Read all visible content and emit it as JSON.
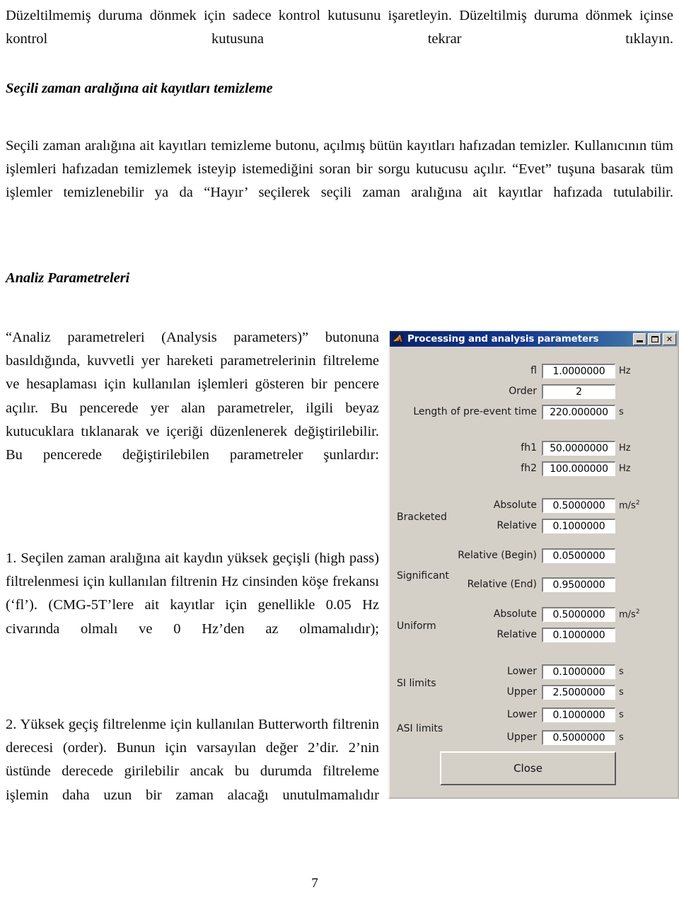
{
  "document": {
    "paragraphs": [
      {
        "id": "p1",
        "text": "Düzeltilmemiş duruma dönmek için sadece kontrol kutusunu işaretleyin. Düzeltilmiş duruma dönmek içinse kontrol kutusuna tekrar tıklayın."
      },
      {
        "id": "p2",
        "text": "Seçili zaman aralığına ait kayıtları temizleme butonu, açılmış bütün kayıtları hafızadan temizler. Kullanıcının tüm işlemleri hafızadan temizlemek isteyip istemediğini soran bir sorgu kutucusu açılır. “Evet” tuşuna basarak tüm işlemler temizlenebilir ya da “Hayır’ seçilerek seçili zaman aralığına ait kayıtlar hafızada tutulabilir."
      },
      {
        "id": "p3",
        "text": "“Analiz parametreleri (Analysis parameters)” butonuna basıldığında, kuvvetli yer hareketi parametrelerinin filtreleme ve hesaplaması için kullanılan işlemleri gösteren bir pencere açılır. Bu pencerede yer alan parametreler, ilgili beyaz kutucuklara tıklanarak ve içeriği düzenlenerek değiştirilebilir. Bu pencerede değiştirilebilen parametreler şunlardır:"
      },
      {
        "id": "p4",
        "text": "1. Seçilen zaman aralığına ait kaydın yüksek geçişli (high pass) filtrelenmesi için kullanılan filtrenin Hz cinsinden köşe frekansı (‘fl’). (CMG-5T’lere ait kayıtlar için genellikle 0.05 Hz civarında olmalı ve 0 Hz’den az olmamalıdır);"
      },
      {
        "id": "p5",
        "text": "2. Yüksek geçiş filtrelenme için kullanılan Butterworth filtrenin derecesi (order). Bunun için varsayılan değer 2’dir. 2’nin üstünde derecede girilebilir ancak bu durumda filtreleme işlemin daha uzun bir zaman alacağı unutulmamalıdır"
      }
    ],
    "headings": [
      {
        "id": "h1",
        "text": "Seçili zaman aralığına ait kayıtları temizleme"
      },
      {
        "id": "h2",
        "text": "Analiz Parametreleri"
      }
    ],
    "page_number": "7"
  },
  "dialog": {
    "title": "Processing and analysis parameters",
    "icon": "matlab-logo-icon",
    "window_controls": {
      "minimize": "minimize-icon",
      "maximize": "maximize-icon",
      "close": "close-icon"
    },
    "close_button_label": "Close",
    "rows": [
      {
        "group": "",
        "label": "fl",
        "value": "1.0000000",
        "unit": "Hz",
        "unit_sup": "",
        "label_wide": false
      },
      {
        "group": "",
        "label": "Order",
        "value": "2",
        "unit": "",
        "unit_sup": "",
        "label_wide": false
      },
      {
        "group": "",
        "label": "Length of pre-event time",
        "value": "220.000000",
        "unit": "s",
        "unit_sup": "",
        "label_wide": true
      },
      {
        "group": "",
        "label": "fh1",
        "value": "50.0000000",
        "unit": "Hz",
        "unit_sup": "",
        "label_wide": false
      },
      {
        "group": "",
        "label": "fh2",
        "value": "100.000000",
        "unit": "Hz",
        "unit_sup": "",
        "label_wide": false
      },
      {
        "group": "",
        "label": "Absolute",
        "value": "0.5000000",
        "unit": "m/s",
        "unit_sup": "2",
        "label_wide": false
      },
      {
        "group": "Bracketed",
        "label": "Relative",
        "value": "0.1000000",
        "unit": "",
        "unit_sup": "",
        "label_wide": false
      },
      {
        "group": "",
        "label": "Relative (Begin)",
        "value": "0.0500000",
        "unit": "",
        "unit_sup": "",
        "label_wide": false
      },
      {
        "group": "Significant",
        "label": "Relative (End)",
        "value": "0.9500000",
        "unit": "",
        "unit_sup": "",
        "label_wide": false
      },
      {
        "group": "",
        "label": "Absolute",
        "value": "0.5000000",
        "unit": "m/s",
        "unit_sup": "2",
        "label_wide": false
      },
      {
        "group": "Uniform",
        "label": "Relative",
        "value": "0.1000000",
        "unit": "",
        "unit_sup": "",
        "label_wide": false
      },
      {
        "group": "",
        "label": "Lower",
        "value": "0.1000000",
        "unit": "s",
        "unit_sup": "",
        "label_wide": false
      },
      {
        "group": "SI limits",
        "label": "Upper",
        "value": "2.5000000",
        "unit": "s",
        "unit_sup": "",
        "label_wide": false
      },
      {
        "group": "",
        "label": "Lower",
        "value": "0.1000000",
        "unit": "s",
        "unit_sup": "",
        "label_wide": false
      },
      {
        "group": "ASI limits",
        "label": "Upper",
        "value": "0.5000000",
        "unit": "s",
        "unit_sup": "",
        "label_wide": false
      }
    ],
    "colors": {
      "face": "#d4d0c8",
      "titlebar_start": "#0a246a",
      "titlebar_end": "#8aa8c8",
      "field_bg": "#ffffff"
    }
  }
}
